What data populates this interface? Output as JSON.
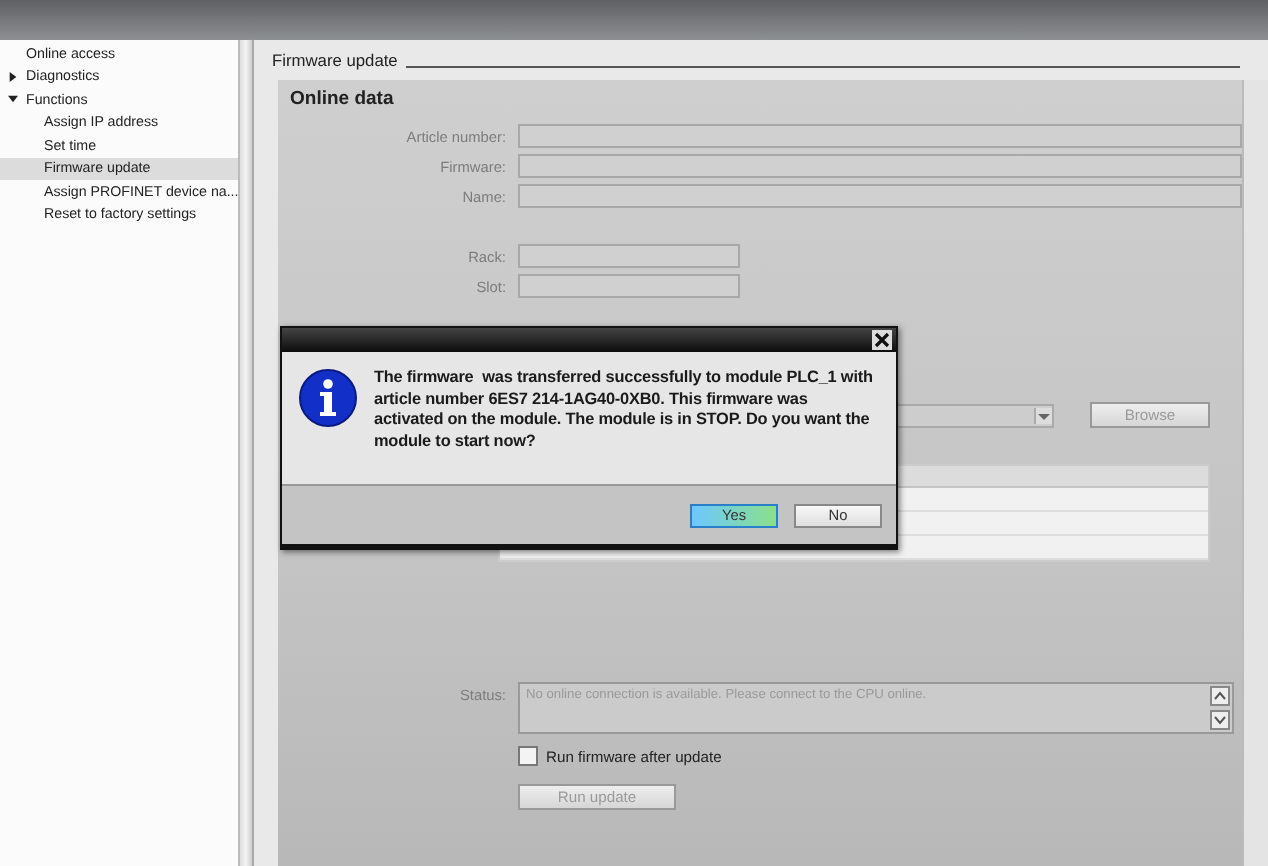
{
  "sidebar": {
    "items": [
      {
        "label": "Online access",
        "selected": false
      },
      {
        "label": "Diagnostics",
        "expanded": false,
        "selected": false
      },
      {
        "label": "Functions",
        "expanded": true,
        "selected": false,
        "children": [
          {
            "label": "Assign IP address",
            "selected": false
          },
          {
            "label": "Set time",
            "selected": false
          },
          {
            "label": "Firmware update",
            "selected": true
          },
          {
            "label": "Assign PROFINET device na...",
            "selected": false
          },
          {
            "label": "Reset to factory settings",
            "selected": false
          }
        ]
      }
    ]
  },
  "section_title": "Firmware update",
  "online_data": {
    "title": "Online data",
    "fields": [
      {
        "label": "Article number:",
        "kind": "long"
      },
      {
        "label": "Firmware:",
        "kind": "long"
      },
      {
        "label": "Name:",
        "kind": "long"
      },
      {
        "label": "Rack:",
        "kind": "short"
      },
      {
        "label": "Slot:",
        "kind": "short"
      }
    ]
  },
  "browse_button": {
    "label": "Browse",
    "disabled": true
  },
  "status": {
    "label": "Status:",
    "value": "No online connection is available. Please connect to the CPU online."
  },
  "run_checkbox": {
    "label": "Run firmware after update",
    "checked": false
  },
  "run_button": {
    "label": "Run update",
    "disabled": true
  },
  "dialog": {
    "message": "The firmware  was transferred successfully to module PLC_1 with article number 6ES7 214-1AG40-0XB0. This firmware was activated on the module. The module is in STOP. Do you want the module to start now?",
    "buttons": [
      {
        "label": "Yes",
        "selected": true
      },
      {
        "label": "No",
        "selected": false
      }
    ]
  }
}
